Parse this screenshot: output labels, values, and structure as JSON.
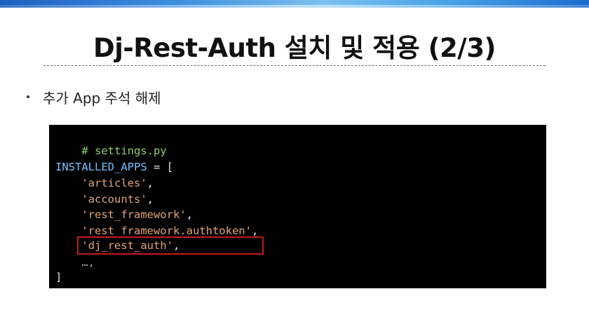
{
  "slide": {
    "title": "Dj-Rest-Auth 설치 및 적용 (2/3)",
    "bullet": "추가 App 주석 해제"
  },
  "code": {
    "comment": "# settings.py",
    "assign_name": "INSTALLED_APPS",
    "assign_op": " = [",
    "items": [
      "'articles'",
      "'accounts'",
      "'rest_framework'",
      "'rest_framework.authtoken'",
      "'dj_rest_auth'"
    ],
    "comma": ",",
    "ellipsis": "…,",
    "close": "]",
    "highlighted_item": "'dj_rest_auth'"
  },
  "colors": {
    "comment": "#8fcf6a",
    "name": "#6ec3ff",
    "string": "#e0a476",
    "highlight_border": "#c21a1a",
    "code_bg": "#000000"
  }
}
